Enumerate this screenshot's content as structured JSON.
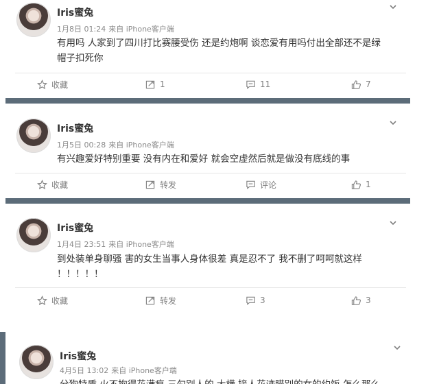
{
  "posts": [
    {
      "username": "Iris蜜兔",
      "time": "1月8日 01:24",
      "source": "来自 iPhone客户端",
      "text_lines": [
        "有用吗 人家到了四川打比赛腰受伤 还是约炮啊 谈恋爱有用吗付出全部还不是绿",
        "帽子扣死你"
      ],
      "actions": {
        "favorite": "收藏",
        "repost": "1",
        "comment": "11",
        "like": "7"
      }
    },
    {
      "username": "Iris蜜兔",
      "time": "1月5日 00:28",
      "source": "来自 iPhone客户端",
      "text_lines": [
        "有兴趣爱好特别重要 没有内在和爱好 就会空虚然后就是做没有底线的事"
      ],
      "actions": {
        "favorite": "收藏",
        "repost": "转发",
        "comment": "评论",
        "like": "1"
      }
    },
    {
      "username": "Iris蜜兔",
      "time": "1月4日 23:51",
      "source": "来自 iPhone客户端",
      "text_lines": [
        "到处装单身聊骚 害的女生当事人身体很差 真是忍不了 我不删了呵呵就这样",
        "！！！！！"
      ],
      "actions": {
        "favorite": "收藏",
        "repost": "转发",
        "comment": "3",
        "like": "3"
      }
    },
    {
      "username": "Iris蜜兔",
      "time": "4月5日 13:02",
      "source": "来自 iPhone客户端",
      "text_lines": [
        "分狗特质 火不拘得花满痕 三勾别人的 大横 接人花迹瞄别的女的约饭 怎么那么"
      ]
    }
  ],
  "colors": {
    "separator": "#5c6c79",
    "meta": "#8a8a8a",
    "icon": "#808080"
  }
}
